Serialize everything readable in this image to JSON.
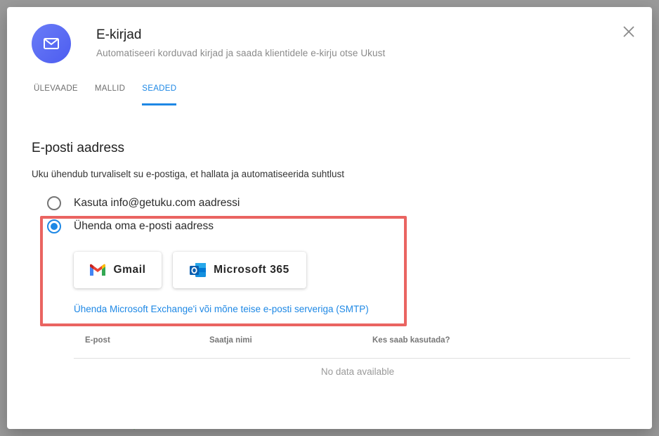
{
  "dialog": {
    "title": "E-kirjad",
    "subtitle": "Automatiseeri korduvad kirjad ja saada klientidele e-kirju otse Ukust",
    "app_icon": "mail-icon",
    "close_icon": "close-icon"
  },
  "tabs": [
    {
      "label": "ÜLEVAADE",
      "active": false
    },
    {
      "label": "MALLID",
      "active": false
    },
    {
      "label": "SEADED",
      "active": true
    }
  ],
  "section": {
    "title": "E-posti aadress",
    "description": "Uku ühendub turvaliselt su e-postiga, et hallata ja automatiseerida suhtlust"
  },
  "options": [
    {
      "label": "Kasuta info@getuku.com aadressi",
      "checked": false
    },
    {
      "label": "Ühenda oma e-posti aadress",
      "checked": true
    }
  ],
  "providers": {
    "gmail": {
      "label": "Gmail",
      "icon": "gmail-icon"
    },
    "microsoft": {
      "label": "Microsoft 365",
      "icon": "outlook-icon"
    }
  },
  "smtp_link": "Ühenda Microsoft Exchange'i või mõne teise e-posti serveriga (SMTP)",
  "table": {
    "columns": [
      "E-post",
      "Saatja nimi",
      "Kes saab kasutada?"
    ],
    "empty_text": "No data available"
  },
  "colors": {
    "accent": "#1e88e5",
    "highlight": "#ea6461",
    "app_icon_bg": "#5b6cf4"
  }
}
